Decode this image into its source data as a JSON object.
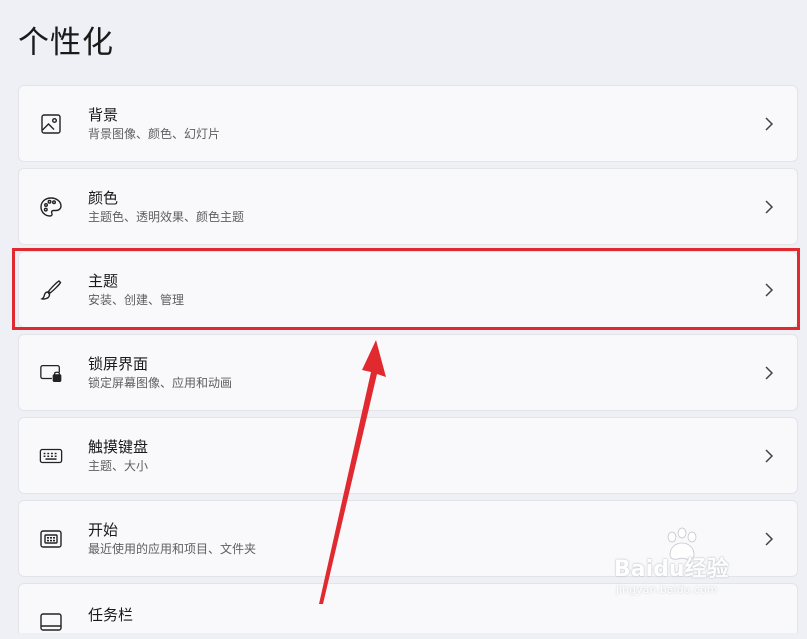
{
  "page": {
    "title": "个性化"
  },
  "items": [
    {
      "title": "背景",
      "subtitle": "背景图像、颜色、幻灯片",
      "icon": "image-icon"
    },
    {
      "title": "颜色",
      "subtitle": "主题色、透明效果、颜色主题",
      "icon": "palette-icon"
    },
    {
      "title": "主题",
      "subtitle": "安装、创建、管理",
      "icon": "brush-icon"
    },
    {
      "title": "锁屏界面",
      "subtitle": "锁定屏幕图像、应用和动画",
      "icon": "lock-screen-icon"
    },
    {
      "title": "触摸键盘",
      "subtitle": "主题、大小",
      "icon": "keyboard-icon"
    },
    {
      "title": "开始",
      "subtitle": "最近使用的应用和项目、文件夹",
      "icon": "start-menu-icon"
    },
    {
      "title": "任务栏",
      "subtitle": "",
      "icon": "taskbar-icon"
    }
  ],
  "annotation": {
    "highlight_color": "#e02a30",
    "highlighted_item": "主题"
  },
  "watermark": {
    "brand": "Baidu经验",
    "url": "jingyan.baidu.com"
  }
}
